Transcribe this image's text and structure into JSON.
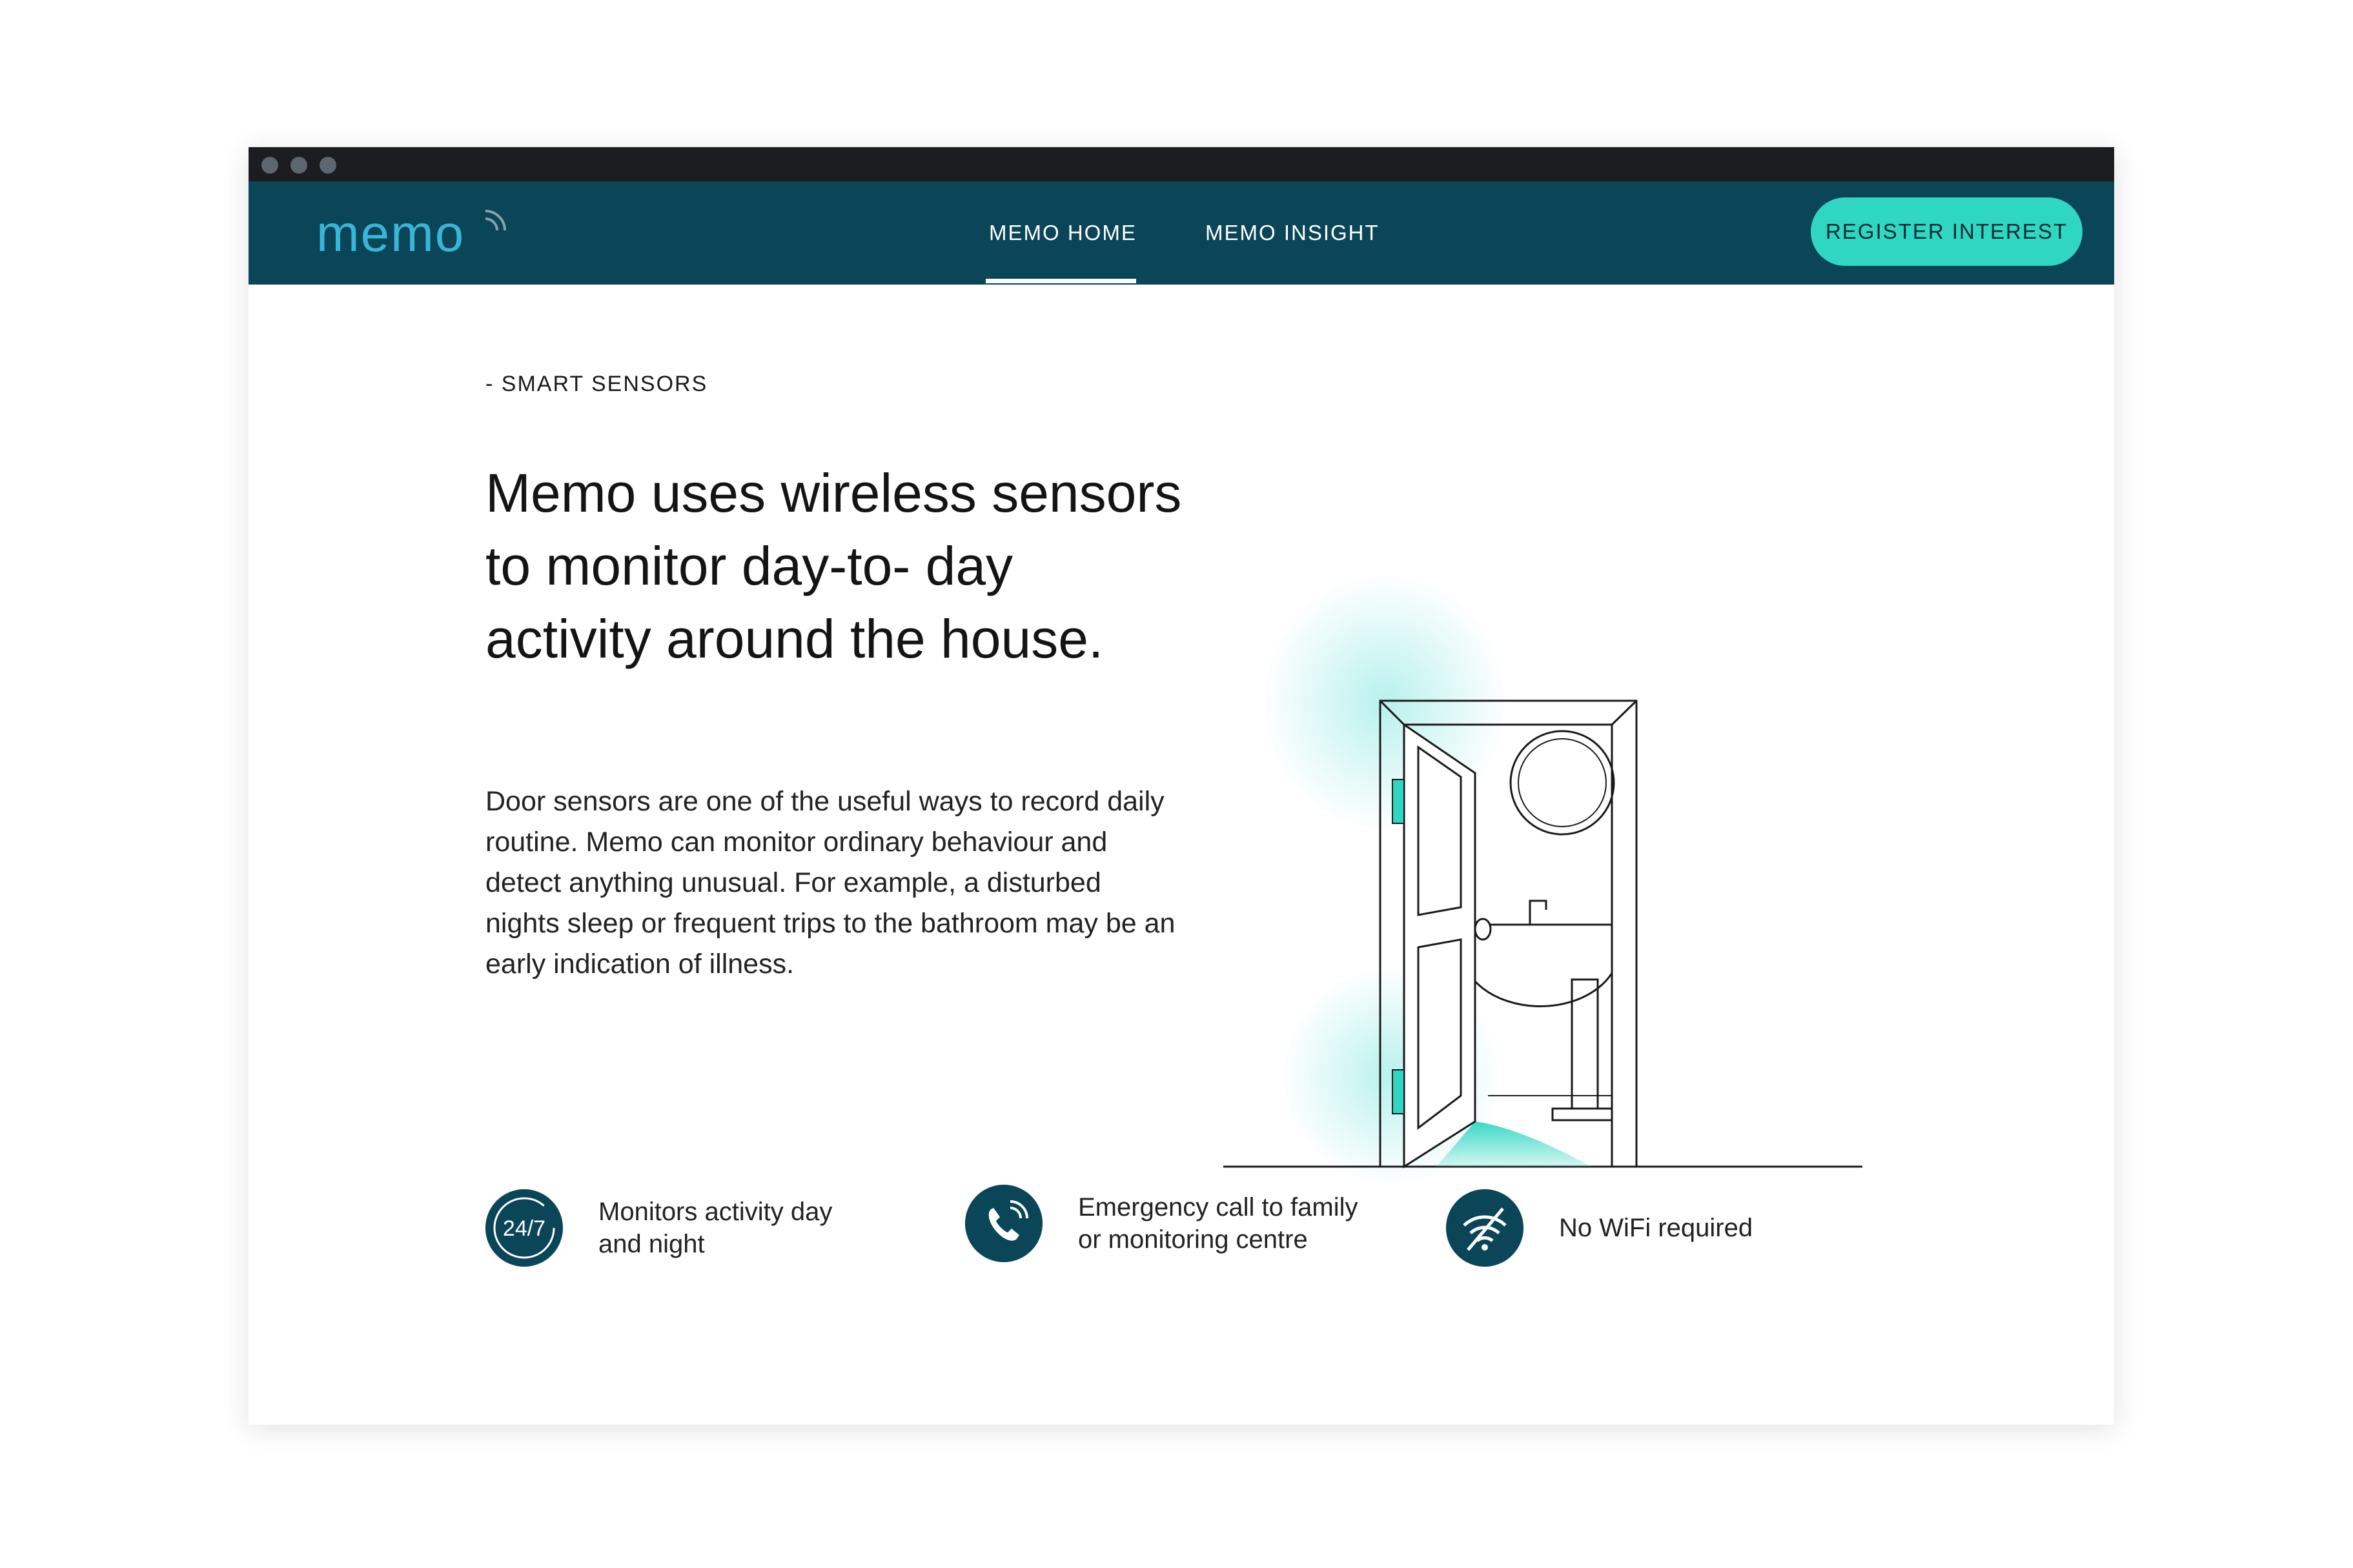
{
  "nav": {
    "logo_text": "memo",
    "links": [
      {
        "label": "MEMO HOME",
        "active": true
      },
      {
        "label": "MEMO INSIGHT",
        "active": false
      }
    ],
    "cta_label": "REGISTER INTEREST"
  },
  "hero": {
    "eyebrow": "- SMART SENSORS",
    "headline": "Memo uses wireless sensors to monitor day-to- day activity around the house.",
    "body": "Door sensors are one of the useful ways to record daily routine. Memo can monitor ordinary behaviour and detect anything unusual. For example, a disturbed nights sleep or frequent trips to the bathroom may be an early indication of illness."
  },
  "features": [
    {
      "icon": "24-7-icon",
      "icon_text": "24/7",
      "label": "Monitors activity day and night"
    },
    {
      "icon": "phone-icon",
      "label": "Emergency call to family or monitoring centre"
    },
    {
      "icon": "no-wifi-icon",
      "label": "No WiFi required"
    }
  ],
  "colors": {
    "nav_background": "#0a4558",
    "accent": "#2fd6c2",
    "chrome": "#1b1d20"
  }
}
